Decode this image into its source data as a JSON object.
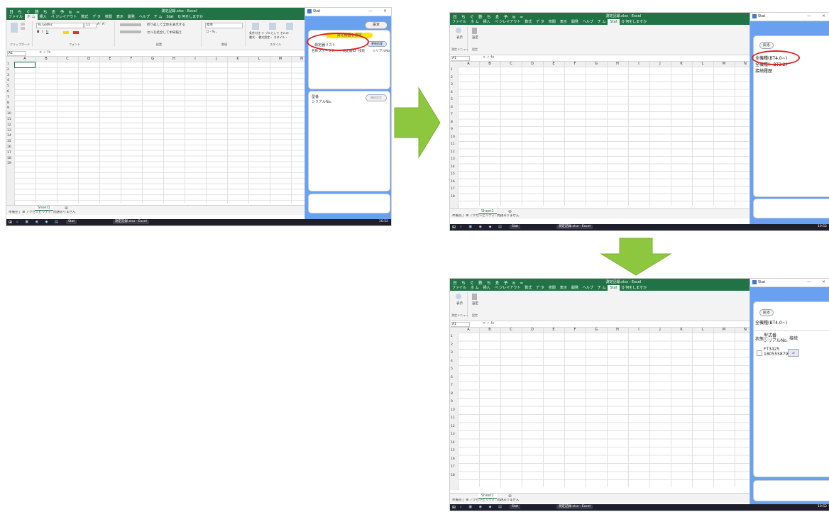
{
  "colors": {
    "excel_green": "#217346",
    "panel_blue": "#6aa0f0",
    "arrow_green": "#8dc63f",
    "highlight_red": "#e02020",
    "yellow_button": "#ffe600"
  },
  "excel": {
    "quick_access": "日 ち ぐ 鉄 ち ゑ 予 ≋ =",
    "doc_title": "測定記録.xlsx - Excel",
    "tabs_full": [
      "ファイル",
      "ホーム",
      "挿入",
      "ページレイアウト",
      "数式",
      "データ",
      "校閲",
      "表示",
      "開発",
      "ヘルプ",
      "チーム",
      "Stat",
      "Q 何をしますか"
    ],
    "tabs_short": [
      "ファイル",
      "ホ ム",
      "挿入",
      "ペ ジレイアウト",
      "数式",
      "デ タ",
      "校閲",
      "表示",
      "開発",
      "ヘルプ",
      "チ ム",
      "Stat",
      "Q 何をしますか"
    ],
    "font_name": "Yu Gothic",
    "font_size": "11",
    "name_box": "A1",
    "fx_symbol": "× ✓ fx",
    "ribbon_group_labels": [
      "クリップボード",
      "フォント",
      "配置",
      "数値",
      "スタイル"
    ],
    "ribbon_wrap_text": "折り返して全体を表示する",
    "ribbon_merge": "セルを結合して中央揃え",
    "ribbon_number_format": "標準",
    "ribbon_conditional": "条件付き テ ブルとして セルの",
    "ribbon_conditional_2": "書式・ 書式設定・ スタイル・",
    "ribbon2_labels": [
      "表示",
      "設定"
    ],
    "ribbon2_group_labels": [
      "測定メニュー",
      "設定"
    ],
    "columns": [
      "A",
      "B",
      "C",
      "D",
      "E",
      "F",
      "G",
      "H",
      "I",
      "J",
      "K",
      "L",
      "M",
      "N"
    ],
    "rows": [
      "1",
      "2",
      "3",
      "4",
      "5",
      "6",
      "7",
      "8",
      "9",
      "10",
      "11",
      "12",
      "13",
      "14",
      "15",
      "16",
      "17",
      "18",
      "19"
    ],
    "sheet_tab": "Sheet1",
    "add_sheet": "⊕",
    "status_text": "準備完了  ⊞  アクセシビリティ: 問題ありません",
    "taskbar": {
      "app_stat": "Stat",
      "app_excel": "測定記録.xlsx - Excel",
      "clock": "10:52"
    }
  },
  "panel": {
    "title": "Stat",
    "ctrl_min": "—",
    "ctrl_close": "×",
    "settings_button": "設定",
    "measure_button": "測定機器を選択",
    "list_label": "測定器リスト",
    "update_button": "更新処理",
    "list_headers": [
      "名称",
      "ステータス",
      "測定器ID",
      "接続",
      "シリアルNo"
    ],
    "detail_label_1": "型番",
    "detail_label_2": "シリアルNo.",
    "detail_button": "構成設定",
    "back_button": "戻る",
    "menu_items": [
      "全機種(BT4.0~)",
      "全機種(~BT3.2)",
      "接続履歴"
    ],
    "selected_category": "全機種(BT4.0~)",
    "table_headers": {
      "state": "状態",
      "model": "型式番",
      "serial": "シリアルNo.",
      "connect": "接続"
    },
    "device": {
      "model": "FT3425",
      "serial": "180555879"
    }
  }
}
